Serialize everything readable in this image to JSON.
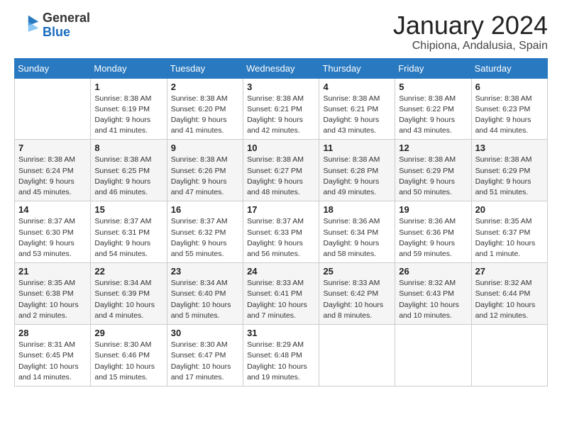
{
  "logo": {
    "general": "General",
    "blue": "Blue"
  },
  "title": {
    "month_year": "January 2024",
    "location": "Chipiona, Andalusia, Spain"
  },
  "headers": [
    "Sunday",
    "Monday",
    "Tuesday",
    "Wednesday",
    "Thursday",
    "Friday",
    "Saturday"
  ],
  "weeks": [
    [
      {
        "day": "",
        "sunrise": "",
        "sunset": "",
        "daylight": ""
      },
      {
        "day": "1",
        "sunrise": "Sunrise: 8:38 AM",
        "sunset": "Sunset: 6:19 PM",
        "daylight": "Daylight: 9 hours and 41 minutes."
      },
      {
        "day": "2",
        "sunrise": "Sunrise: 8:38 AM",
        "sunset": "Sunset: 6:20 PM",
        "daylight": "Daylight: 9 hours and 41 minutes."
      },
      {
        "day": "3",
        "sunrise": "Sunrise: 8:38 AM",
        "sunset": "Sunset: 6:21 PM",
        "daylight": "Daylight: 9 hours and 42 minutes."
      },
      {
        "day": "4",
        "sunrise": "Sunrise: 8:38 AM",
        "sunset": "Sunset: 6:21 PM",
        "daylight": "Daylight: 9 hours and 43 minutes."
      },
      {
        "day": "5",
        "sunrise": "Sunrise: 8:38 AM",
        "sunset": "Sunset: 6:22 PM",
        "daylight": "Daylight: 9 hours and 43 minutes."
      },
      {
        "day": "6",
        "sunrise": "Sunrise: 8:38 AM",
        "sunset": "Sunset: 6:23 PM",
        "daylight": "Daylight: 9 hours and 44 minutes."
      }
    ],
    [
      {
        "day": "7",
        "sunrise": "Sunrise: 8:38 AM",
        "sunset": "Sunset: 6:24 PM",
        "daylight": "Daylight: 9 hours and 45 minutes."
      },
      {
        "day": "8",
        "sunrise": "Sunrise: 8:38 AM",
        "sunset": "Sunset: 6:25 PM",
        "daylight": "Daylight: 9 hours and 46 minutes."
      },
      {
        "day": "9",
        "sunrise": "Sunrise: 8:38 AM",
        "sunset": "Sunset: 6:26 PM",
        "daylight": "Daylight: 9 hours and 47 minutes."
      },
      {
        "day": "10",
        "sunrise": "Sunrise: 8:38 AM",
        "sunset": "Sunset: 6:27 PM",
        "daylight": "Daylight: 9 hours and 48 minutes."
      },
      {
        "day": "11",
        "sunrise": "Sunrise: 8:38 AM",
        "sunset": "Sunset: 6:28 PM",
        "daylight": "Daylight: 9 hours and 49 minutes."
      },
      {
        "day": "12",
        "sunrise": "Sunrise: 8:38 AM",
        "sunset": "Sunset: 6:29 PM",
        "daylight": "Daylight: 9 hours and 50 minutes."
      },
      {
        "day": "13",
        "sunrise": "Sunrise: 8:38 AM",
        "sunset": "Sunset: 6:29 PM",
        "daylight": "Daylight: 9 hours and 51 minutes."
      }
    ],
    [
      {
        "day": "14",
        "sunrise": "Sunrise: 8:37 AM",
        "sunset": "Sunset: 6:30 PM",
        "daylight": "Daylight: 9 hours and 53 minutes."
      },
      {
        "day": "15",
        "sunrise": "Sunrise: 8:37 AM",
        "sunset": "Sunset: 6:31 PM",
        "daylight": "Daylight: 9 hours and 54 minutes."
      },
      {
        "day": "16",
        "sunrise": "Sunrise: 8:37 AM",
        "sunset": "Sunset: 6:32 PM",
        "daylight": "Daylight: 9 hours and 55 minutes."
      },
      {
        "day": "17",
        "sunrise": "Sunrise: 8:37 AM",
        "sunset": "Sunset: 6:33 PM",
        "daylight": "Daylight: 9 hours and 56 minutes."
      },
      {
        "day": "18",
        "sunrise": "Sunrise: 8:36 AM",
        "sunset": "Sunset: 6:34 PM",
        "daylight": "Daylight: 9 hours and 58 minutes."
      },
      {
        "day": "19",
        "sunrise": "Sunrise: 8:36 AM",
        "sunset": "Sunset: 6:36 PM",
        "daylight": "Daylight: 9 hours and 59 minutes."
      },
      {
        "day": "20",
        "sunrise": "Sunrise: 8:35 AM",
        "sunset": "Sunset: 6:37 PM",
        "daylight": "Daylight: 10 hours and 1 minute."
      }
    ],
    [
      {
        "day": "21",
        "sunrise": "Sunrise: 8:35 AM",
        "sunset": "Sunset: 6:38 PM",
        "daylight": "Daylight: 10 hours and 2 minutes."
      },
      {
        "day": "22",
        "sunrise": "Sunrise: 8:34 AM",
        "sunset": "Sunset: 6:39 PM",
        "daylight": "Daylight: 10 hours and 4 minutes."
      },
      {
        "day": "23",
        "sunrise": "Sunrise: 8:34 AM",
        "sunset": "Sunset: 6:40 PM",
        "daylight": "Daylight: 10 hours and 5 minutes."
      },
      {
        "day": "24",
        "sunrise": "Sunrise: 8:33 AM",
        "sunset": "Sunset: 6:41 PM",
        "daylight": "Daylight: 10 hours and 7 minutes."
      },
      {
        "day": "25",
        "sunrise": "Sunrise: 8:33 AM",
        "sunset": "Sunset: 6:42 PM",
        "daylight": "Daylight: 10 hours and 8 minutes."
      },
      {
        "day": "26",
        "sunrise": "Sunrise: 8:32 AM",
        "sunset": "Sunset: 6:43 PM",
        "daylight": "Daylight: 10 hours and 10 minutes."
      },
      {
        "day": "27",
        "sunrise": "Sunrise: 8:32 AM",
        "sunset": "Sunset: 6:44 PM",
        "daylight": "Daylight: 10 hours and 12 minutes."
      }
    ],
    [
      {
        "day": "28",
        "sunrise": "Sunrise: 8:31 AM",
        "sunset": "Sunset: 6:45 PM",
        "daylight": "Daylight: 10 hours and 14 minutes."
      },
      {
        "day": "29",
        "sunrise": "Sunrise: 8:30 AM",
        "sunset": "Sunset: 6:46 PM",
        "daylight": "Daylight: 10 hours and 15 minutes."
      },
      {
        "day": "30",
        "sunrise": "Sunrise: 8:30 AM",
        "sunset": "Sunset: 6:47 PM",
        "daylight": "Daylight: 10 hours and 17 minutes."
      },
      {
        "day": "31",
        "sunrise": "Sunrise: 8:29 AM",
        "sunset": "Sunset: 6:48 PM",
        "daylight": "Daylight: 10 hours and 19 minutes."
      },
      {
        "day": "",
        "sunrise": "",
        "sunset": "",
        "daylight": ""
      },
      {
        "day": "",
        "sunrise": "",
        "sunset": "",
        "daylight": ""
      },
      {
        "day": "",
        "sunrise": "",
        "sunset": "",
        "daylight": ""
      }
    ]
  ]
}
